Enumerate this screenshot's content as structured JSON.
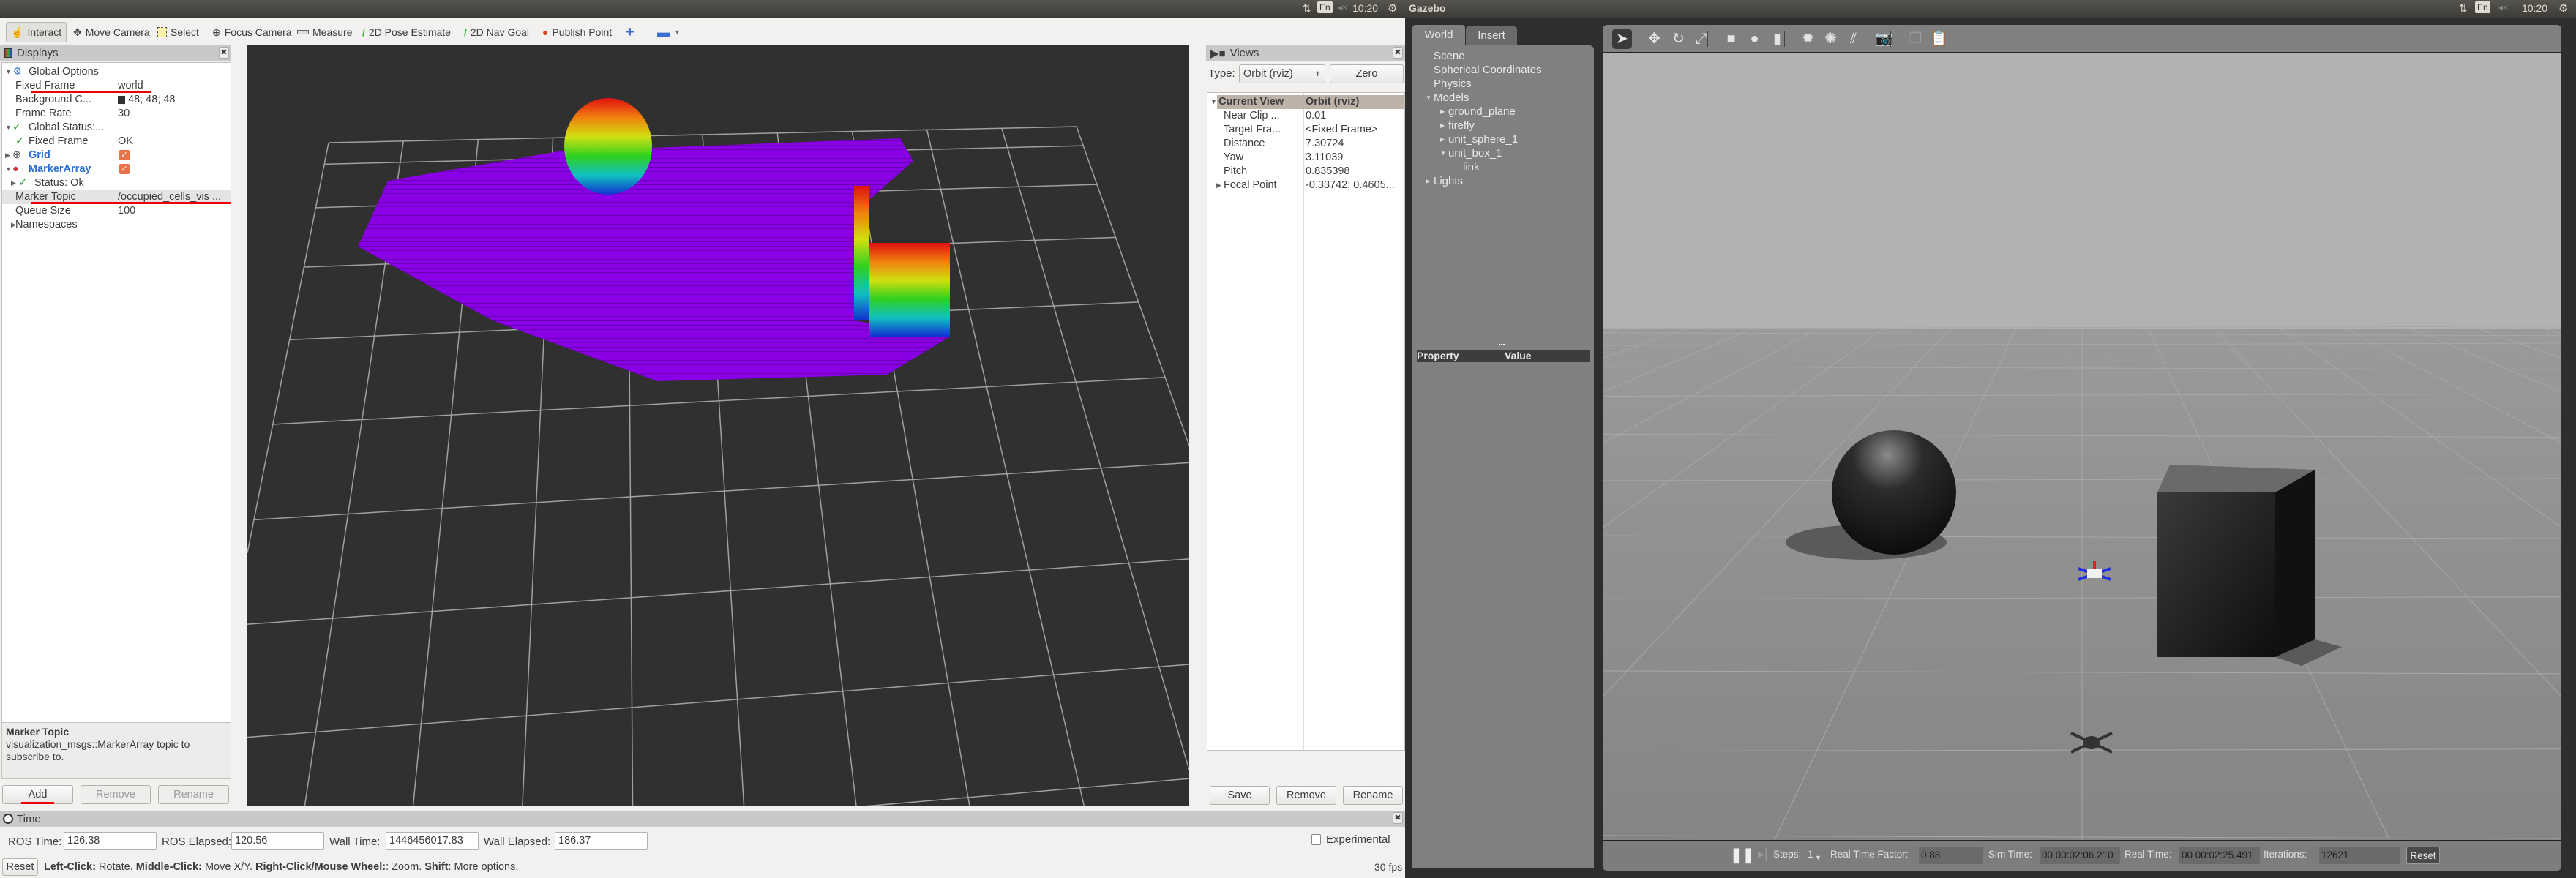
{
  "topbar": {
    "right_title": "Gazebo",
    "lang": "En",
    "clock_left": "10:20",
    "clock_right": "10:20"
  },
  "rviz": {
    "toolbar": [
      {
        "label": "Interact",
        "icon": "hand-icon",
        "active": true
      },
      {
        "label": "Move Camera",
        "icon": "move-camera-icon"
      },
      {
        "label": "Select",
        "icon": "select-icon"
      },
      {
        "label": "Focus Camera",
        "icon": "focus-camera-icon"
      },
      {
        "label": "Measure",
        "icon": "ruler-icon"
      },
      {
        "label": "2D Pose Estimate",
        "icon": "green-arrow-icon"
      },
      {
        "label": "2D Nav Goal",
        "icon": "green-arrow-icon"
      },
      {
        "label": "Publish Point",
        "icon": "map-pin-icon"
      }
    ],
    "displays": {
      "title": "Displays",
      "rows": [
        {
          "name": "Global Options",
          "value": ""
        },
        {
          "name": "Fixed Frame",
          "value": "world"
        },
        {
          "name": "Background C...",
          "value": "48; 48; 48"
        },
        {
          "name": "Frame Rate",
          "value": "30"
        },
        {
          "name": "Global Status:...",
          "value": ""
        },
        {
          "name": "Fixed Frame",
          "value": "OK"
        },
        {
          "name": "Grid",
          "value": ""
        },
        {
          "name": "MarkerArray",
          "value": ""
        },
        {
          "name": "Status: Ok",
          "value": ""
        },
        {
          "name": "Marker Topic",
          "value": "/occupied_cells_vis ..."
        },
        {
          "name": "Queue Size",
          "value": "100"
        },
        {
          "name": "Namespaces",
          "value": ""
        }
      ],
      "background_color": "#303030",
      "grid_checked": true,
      "markerarray_checked": true,
      "description_title": "Marker Topic",
      "description_text": "visualization_msgs::MarkerArray topic to subscribe to.",
      "add": "Add",
      "remove": "Remove",
      "rename": "Rename"
    },
    "views": {
      "title": "Views",
      "type_label": "Type:",
      "type_value": "Orbit (rviz)",
      "zero": "Zero",
      "rows": [
        {
          "name": "Current View",
          "value": "Orbit (rviz)"
        },
        {
          "name": "Near Clip ...",
          "value": "0.01"
        },
        {
          "name": "Target Fra...",
          "value": "<Fixed Frame>"
        },
        {
          "name": "Distance",
          "value": "7.30724"
        },
        {
          "name": "Yaw",
          "value": "3.11039"
        },
        {
          "name": "Pitch",
          "value": "0.835398"
        },
        {
          "name": "Focal Point",
          "value": "-0.33742; 0.4605..."
        }
      ],
      "save": "Save",
      "remove": "Remove",
      "rename": "Rename"
    },
    "time": {
      "title": "Time",
      "ros_time_label": "ROS Time:",
      "ros_time": "126.38",
      "ros_elapsed_label": "ROS Elapsed:",
      "ros_elapsed": "120.56",
      "wall_time_label": "Wall Time:",
      "wall_time": "1446456017.83",
      "wall_elapsed_label": "Wall Elapsed:",
      "wall_elapsed": "186.37",
      "experimental": "Experimental",
      "experimental_checked": false
    },
    "status": {
      "reset": "Reset",
      "k1": "Left-Click:",
      "v1": " Rotate. ",
      "k2": "Middle-Click:",
      "v2": " Move X/Y. ",
      "k3": "Right-Click/Mouse Wheel:",
      "v3": ": Zoom. ",
      "k4": "Shift",
      "v4": ": More options.",
      "fps": "30 fps"
    },
    "scene_colors": {
      "occupied": "#8a00e6",
      "background": "#303030"
    }
  },
  "gazebo": {
    "tabs": [
      "World",
      "Insert"
    ],
    "tree": [
      {
        "label": "Scene",
        "level": 0,
        "arrow": ""
      },
      {
        "label": "Spherical Coordinates",
        "level": 0,
        "arrow": ""
      },
      {
        "label": "Physics",
        "level": 0,
        "arrow": ""
      },
      {
        "label": "Models",
        "level": 0,
        "arrow": "down"
      },
      {
        "label": "ground_plane",
        "level": 1,
        "arrow": "right"
      },
      {
        "label": "firefly",
        "level": 1,
        "arrow": "right"
      },
      {
        "label": "unit_sphere_1",
        "level": 1,
        "arrow": "right"
      },
      {
        "label": "unit_box_1",
        "level": 1,
        "arrow": "down"
      },
      {
        "label": "link",
        "level": 2,
        "arrow": ""
      },
      {
        "label": "Lights",
        "level": 0,
        "arrow": "right"
      }
    ],
    "property_header": "Property",
    "value_header": "Value",
    "tools": [
      "select-arrow-icon",
      "translate-icon",
      "rotate-icon",
      "scale-icon",
      "box-icon",
      "sphere-icon",
      "cylinder-icon",
      "point-light-icon",
      "spot-light-icon",
      "directional-light-icon",
      "screenshot-icon",
      "copy-icon",
      "paste-icon"
    ],
    "bottom": {
      "steps_label": "Steps:",
      "steps": "1",
      "rtf_label": "Real Time Factor:",
      "rtf": "0.88",
      "sim_time_label": "Sim Time:",
      "sim_time": "00 00:02:06.210",
      "real_time_label": "Real Time:",
      "real_time": "00 00:02:25.491",
      "iterations_label": "Iterations:",
      "iterations": "12621",
      "reset": "Reset"
    }
  }
}
